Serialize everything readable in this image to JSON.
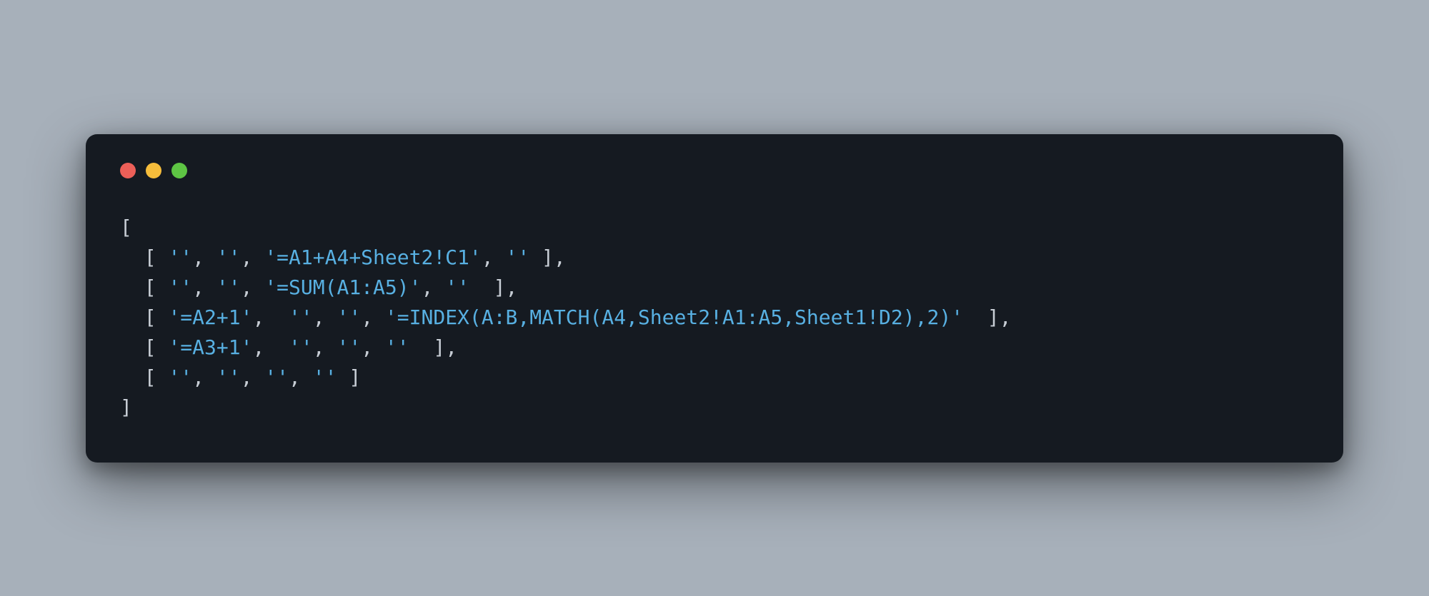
{
  "window": {
    "traffic_lights": {
      "red": "#ec5f58",
      "yellow": "#f6bd3b",
      "green": "#5ec544"
    }
  },
  "code": {
    "open": "[",
    "close": "]",
    "indent": "  ",
    "rows": [
      {
        "cells": [
          "''",
          "''",
          "'=A1+A4+Sheet2!C1'",
          "''"
        ],
        "trailing_comma": true
      },
      {
        "cells": [
          "''",
          "''",
          "'=SUM(A1:A5)'",
          "''"
        ],
        "gap_after_last_comma": "  ",
        "trailing_comma": true
      },
      {
        "cells": [
          "'=A2+1'",
          "''",
          "''",
          "'=INDEX(A:B,MATCH(A4,Sheet2!A1:A5,Sheet1!D2),2)'"
        ],
        "sep_after_first": ",  ",
        "gap_before_close": "  ",
        "trailing_comma": true
      },
      {
        "cells": [
          "'=A3+1'",
          "''",
          "''",
          "''"
        ],
        "sep_after_first": ",  ",
        "gap_before_close": "  ",
        "trailing_comma": true
      },
      {
        "cells": [
          "''",
          "''",
          "''",
          "''"
        ],
        "trailing_comma": false
      }
    ]
  },
  "colors": {
    "bg": "#a7b0ba",
    "panel": "#151a21",
    "text": "#c7cdd5",
    "string": "#58b0e2"
  }
}
